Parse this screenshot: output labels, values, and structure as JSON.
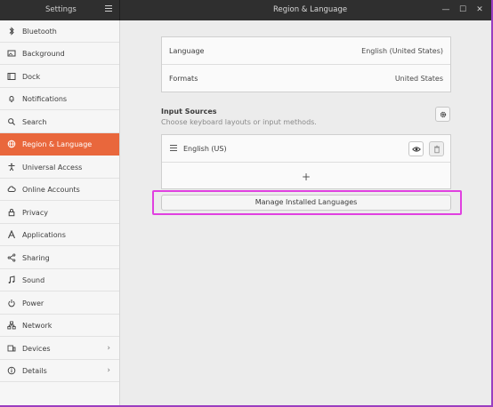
{
  "header": {
    "sidebar_title": "Settings",
    "title": "Region & Language",
    "window_buttons": {
      "minimize": "—",
      "maximize": "☐",
      "close": "✕"
    }
  },
  "sidebar": {
    "items": [
      {
        "label": "Bluetooth",
        "icon": "bluetooth-icon",
        "glyph": "ᛒ"
      },
      {
        "label": "Background",
        "icon": "background-icon",
        "glyph": ""
      },
      {
        "label": "Dock",
        "icon": "dock-icon",
        "glyph": ""
      },
      {
        "label": "Notifications",
        "icon": "bell-icon",
        "glyph": ""
      },
      {
        "label": "Search",
        "icon": "search-icon",
        "glyph": ""
      },
      {
        "label": "Region & Language",
        "icon": "globe-icon",
        "glyph": ""
      },
      {
        "label": "Universal Access",
        "icon": "accessibility-icon",
        "glyph": ""
      },
      {
        "label": "Online Accounts",
        "icon": "cloud-icon",
        "glyph": ""
      },
      {
        "label": "Privacy",
        "icon": "lock-icon",
        "glyph": ""
      },
      {
        "label": "Applications",
        "icon": "applications-icon",
        "glyph": ""
      },
      {
        "label": "Sharing",
        "icon": "share-icon",
        "glyph": ""
      },
      {
        "label": "Sound",
        "icon": "music-note-icon",
        "glyph": "♫"
      },
      {
        "label": "Power",
        "icon": "power-icon",
        "glyph": ""
      },
      {
        "label": "Network",
        "icon": "network-icon",
        "glyph": ""
      },
      {
        "label": "Devices",
        "icon": "devices-icon",
        "glyph": ""
      },
      {
        "label": "Details",
        "icon": "info-icon",
        "glyph": ""
      }
    ],
    "active_index": 5,
    "chevron": "›"
  },
  "language_card": {
    "language_label": "Language",
    "language_value": "English (United States)",
    "formats_label": "Formats",
    "formats_value": "United States"
  },
  "input_sources": {
    "title": "Input Sources",
    "subtitle": "Choose keyboard layouts or input methods.",
    "sources": [
      {
        "label": "English (US)"
      }
    ],
    "add_symbol": "+"
  },
  "manage_button": {
    "label": "Manage Installed Languages"
  },
  "colors": {
    "accent": "#e9673c",
    "highlight": "#e040e0",
    "header": "#2f2f2f"
  }
}
